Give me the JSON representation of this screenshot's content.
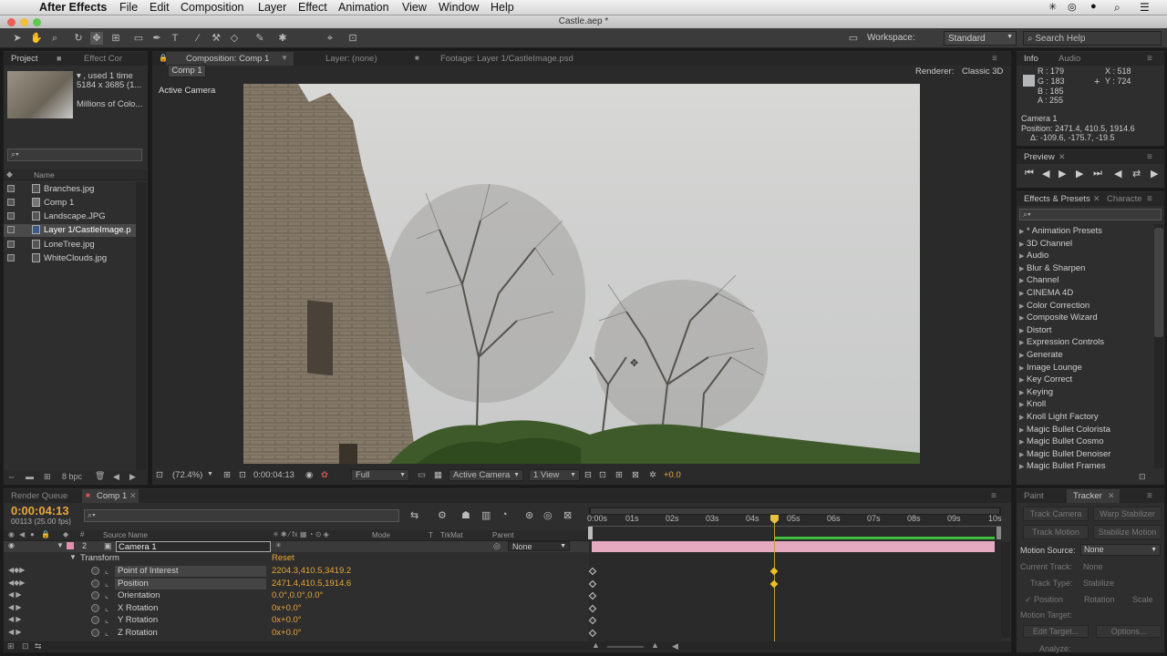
{
  "menubar": {
    "app": "After Effects",
    "items": [
      "File",
      "Edit",
      "Composition",
      "Layer",
      "Effect",
      "Animation",
      "View",
      "Window",
      "Help"
    ]
  },
  "window_title": "Castle.aep *",
  "toolbar": {
    "workspace_label": "Workspace:",
    "workspace_value": "Standard",
    "search_placeholder": "Search Help"
  },
  "project": {
    "tab_project": "Project",
    "tab_effect": "Effect Cor",
    "info_line1": "▾ , used 1 time",
    "info_line2": "5184 x 3685 (1...",
    "info_line3": "Millions of Colo...",
    "col_name": "Name",
    "items": [
      "Branches.jpg",
      "Comp 1",
      "Landscape.JPG",
      "Layer 1/CastleImage.p",
      "LoneTree.jpg",
      "WhiteClouds.jpg"
    ],
    "bpc": "8 bpc"
  },
  "viewer": {
    "tab_comp": "Composition: Comp 1",
    "tab_layer": "Layer: (none)",
    "tab_footage": "Footage: Layer 1/CastleImage.psd",
    "comp_button": "Comp 1",
    "renderer_label": "Renderer:",
    "renderer_value": "Classic 3D",
    "view_label": "Active Camera",
    "zoom": "(72.4%)",
    "timecode": "0:00:04:13",
    "resolution": "Full",
    "camera": "Active Camera",
    "views": "1 View",
    "exposure": "+0.0"
  },
  "info": {
    "tab_info": "Info",
    "tab_audio": "Audio",
    "r": "R : 179",
    "g": "G : 183",
    "b": "B : 185",
    "a": "A : 255",
    "x": "X : 518",
    "y": "Y : 724",
    "layer": "Camera 1",
    "position": "Position: 2471.4, 410.5, 1914.6",
    "delta": "Δ: -109.6, -175.7, -19.5"
  },
  "preview": {
    "tab": "Preview"
  },
  "effects": {
    "tab": "Effects & Presets",
    "tab2": "Characte",
    "items": [
      "* Animation Presets",
      "3D Channel",
      "Audio",
      "Blur & Sharpen",
      "Channel",
      "CINEMA 4D",
      "Color Correction",
      "Composite Wizard",
      "Distort",
      "Expression Controls",
      "Generate",
      "Image Lounge",
      "Key Correct",
      "Keying",
      "Knoll",
      "Knoll Light Factory",
      "Magic Bullet Colorista",
      "Magic Bullet Cosmo",
      "Magic Bullet Denoiser",
      "Magic Bullet Frames"
    ]
  },
  "timeline": {
    "tab_render": "Render Queue",
    "tab_comp": "Comp 1",
    "timecode": "0:00:04:13",
    "frames": "00113 (25.00 fps)",
    "col_source": "Source Name",
    "col_mode": "Mode",
    "col_trkmat": "TrkMat",
    "col_parent": "Parent",
    "layer_num": "2",
    "layer_name": "Camera 1",
    "parent": "None",
    "transform": "Transform",
    "reset": "Reset",
    "props": [
      {
        "name": "Point of Interest",
        "value": "2204.3,410.5,3419.2"
      },
      {
        "name": "Position",
        "value": "2471.4,410.5,1914.6"
      },
      {
        "name": "Orientation",
        "value": "0.0°,0.0°,0.0°"
      },
      {
        "name": "X Rotation",
        "value": "0x+0.0°"
      },
      {
        "name": "Y Rotation",
        "value": "0x+0.0°"
      },
      {
        "name": "Z Rotation",
        "value": "0x+0.0°"
      }
    ],
    "ruler": [
      "0:00s",
      "01s",
      "02s",
      "03s",
      "04s",
      "05s",
      "06s",
      "07s",
      "08s",
      "09s",
      "10s"
    ]
  },
  "tracker": {
    "tab_paint": "Paint",
    "tab_tracker": "Tracker",
    "track_camera": "Track Camera",
    "warp": "Warp Stabilizer",
    "track_motion": "Track Motion",
    "stabilize": "Stabilize Motion",
    "motion_source_label": "Motion Source:",
    "motion_source_value": "None",
    "current_track": "Current Track:",
    "current_track_value": "None",
    "track_type": "Track Type:",
    "track_type_value": "Stabilize",
    "position": "Position",
    "rotation": "Rotation",
    "scale": "Scale",
    "motion_target": "Motion Target:",
    "edit_target": "Edit Target...",
    "options": "Options...",
    "analyze": "Analyze:"
  }
}
